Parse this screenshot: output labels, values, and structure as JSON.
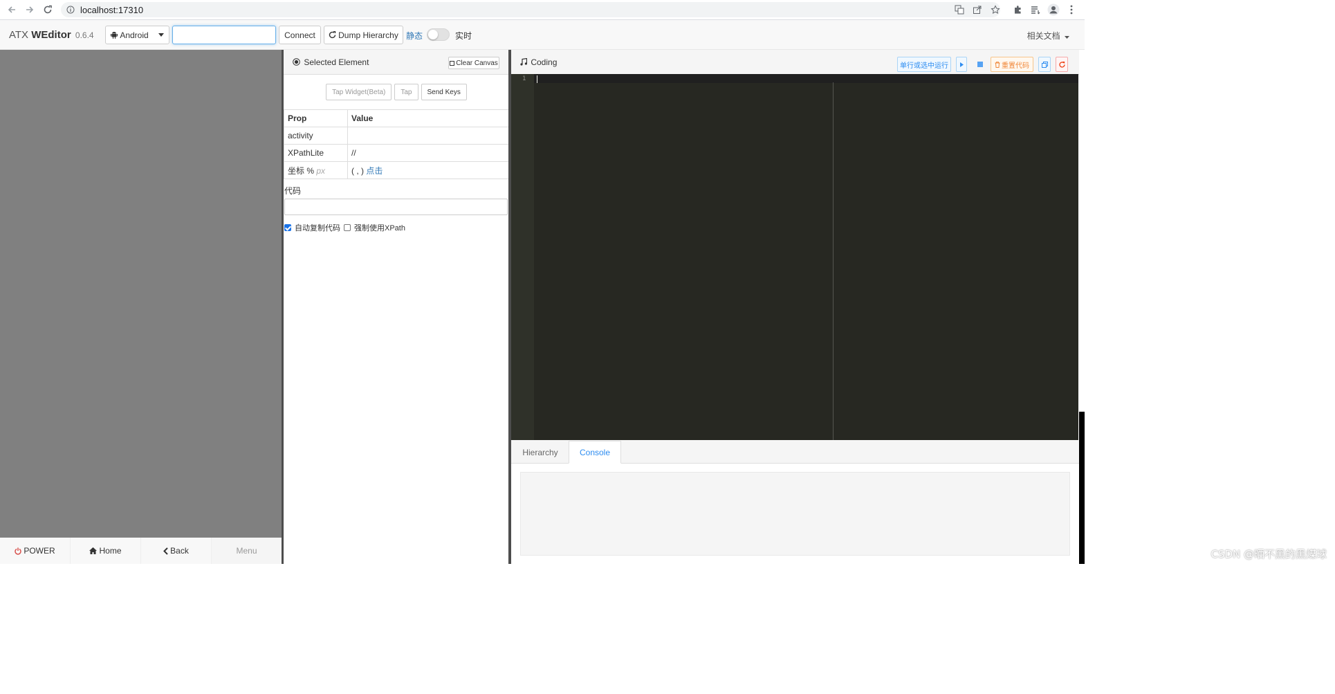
{
  "browser": {
    "url": "localhost:17310",
    "icons": [
      "back-icon",
      "forward-icon",
      "reload-icon",
      "info-icon",
      "translate-icon",
      "share-icon",
      "star-icon",
      "extensions-icon",
      "reading-list-icon",
      "profile-icon",
      "menu-icon"
    ]
  },
  "navbar": {
    "brand_prefix": "ATX ",
    "brand_bold": "WEditor",
    "version": "0.6.4",
    "platform": "Android",
    "serial_value": "",
    "connect_label": "Connect",
    "dump_label": "Dump Hierarchy",
    "mode_static": "静态",
    "mode_live": "实时",
    "live_enabled": false,
    "docs_label": "相关文档"
  },
  "device": {
    "buttons": [
      {
        "label": "POWER",
        "icon": "power-icon"
      },
      {
        "label": "Home",
        "icon": "home-icon"
      },
      {
        "label": "Back",
        "icon": "chevron-left-icon"
      },
      {
        "label": "Menu",
        "icon": ""
      }
    ]
  },
  "selected": {
    "title": "Selected Element",
    "clear_canvas": "Clear Canvas",
    "actions": [
      "Tap Widget(Beta)",
      "Tap",
      "Send Keys"
    ],
    "table": {
      "headers": [
        "Prop",
        "Value"
      ],
      "rows": [
        {
          "prop": "activity",
          "value": ""
        },
        {
          "prop": "XPathLite",
          "value": "//"
        },
        {
          "prop": "坐标 %",
          "prop_extra": "px",
          "value": "( , )",
          "value_link": "点击"
        }
      ]
    },
    "code_label": "代码",
    "code_value": "",
    "checks": [
      {
        "label": "自动复制代码",
        "checked": true
      },
      {
        "label": "强制使用XPath",
        "checked": false
      }
    ]
  },
  "coding": {
    "title": "Coding",
    "toolbar": {
      "run_label": "单行或选中运行",
      "reset_label": "重置代码"
    },
    "line_numbers": [
      "1"
    ],
    "tabs": [
      "Hierarchy",
      "Console"
    ],
    "active_tab": "Console"
  },
  "watermark": "CSDN @晒不黑的黑煤球"
}
